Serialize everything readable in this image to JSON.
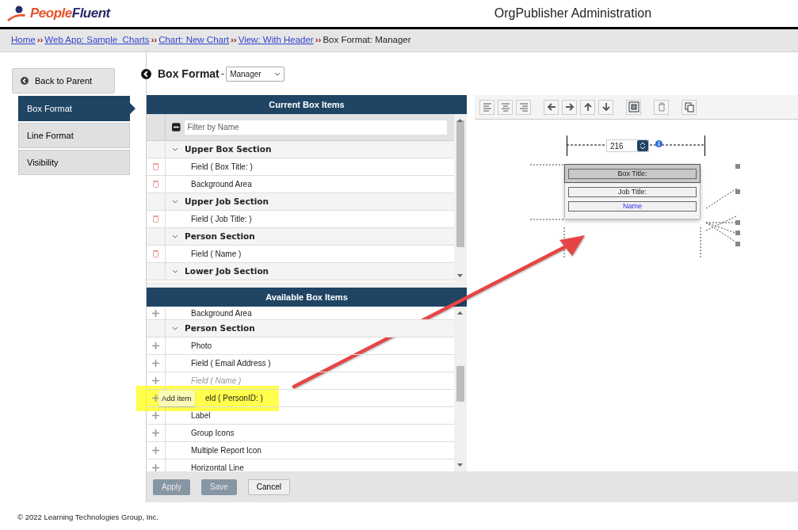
{
  "header": {
    "logo": [
      "People",
      "Fluent"
    ],
    "title": "OrgPublisher Administration"
  },
  "breadcrumb": [
    {
      "text": "Home",
      "link": true
    },
    {
      "text": "Web App: Sample_Charts",
      "link": true
    },
    {
      "text": "Chart: New Chart",
      "link": true
    },
    {
      "text": "View: With Header",
      "link": true
    },
    {
      "text": "Box Format: Manager",
      "link": false
    }
  ],
  "breadcrumb_separator": "››",
  "sidebar": {
    "back_button": "Back to Parent",
    "items": [
      {
        "label": "Box Format",
        "selected": true
      },
      {
        "label": "Line Format",
        "selected": false
      },
      {
        "label": "Visibility",
        "selected": false
      }
    ]
  },
  "heading": {
    "title": "Box Format",
    "separator": "-",
    "select": "Manager"
  },
  "current_items": {
    "title": "Current Box Items",
    "filter_placeholder": "Filter by Name",
    "rows": [
      {
        "kind": "section",
        "label": "Upper Box Section"
      },
      {
        "kind": "item",
        "label": "Field  ( Box Title: )"
      },
      {
        "kind": "item",
        "label": "Background Area"
      },
      {
        "kind": "section",
        "label": "Upper Job Section"
      },
      {
        "kind": "item",
        "label": "Field  ( Job Title: )"
      },
      {
        "kind": "section",
        "label": "Person Section"
      },
      {
        "kind": "item",
        "label": "Field  ( Name )"
      },
      {
        "kind": "section",
        "label": "Lower Job Section"
      }
    ]
  },
  "available_items": {
    "title": "Available Box Items",
    "rows": [
      {
        "kind": "item",
        "label": "Background Area",
        "disabled": false
      },
      {
        "kind": "section",
        "label": "Person Section"
      },
      {
        "kind": "item",
        "label": "Photo",
        "disabled": false
      },
      {
        "kind": "item",
        "label": "Field  ( Email Address )",
        "disabled": false
      },
      {
        "kind": "item",
        "label": "Field  ( Name )",
        "disabled": true
      },
      {
        "kind": "item",
        "label": "eld  ( PersonID: )",
        "disabled": false,
        "highlighted": true,
        "tooltip": "Add item"
      },
      {
        "kind": "item",
        "label": "Label",
        "disabled": false
      },
      {
        "kind": "item",
        "label": "Group Icons",
        "disabled": false
      },
      {
        "kind": "item",
        "label": "Multiple Report Icon",
        "disabled": false
      },
      {
        "kind": "item",
        "label": "Horizontal Line",
        "disabled": false
      }
    ]
  },
  "buttons": [
    {
      "label": "Apply",
      "disabled": true
    },
    {
      "label": "Save",
      "disabled": true
    },
    {
      "label": "Cancel",
      "disabled": false
    }
  ],
  "preview": {
    "width_value": "216",
    "fields": [
      {
        "label": "Box Title:",
        "kind": "title"
      },
      {
        "label": "Job Title:",
        "kind": "plain"
      },
      {
        "label": "Name",
        "kind": "link"
      }
    ]
  },
  "footer": "© 2022 Learning Technologies Group, Inc."
}
